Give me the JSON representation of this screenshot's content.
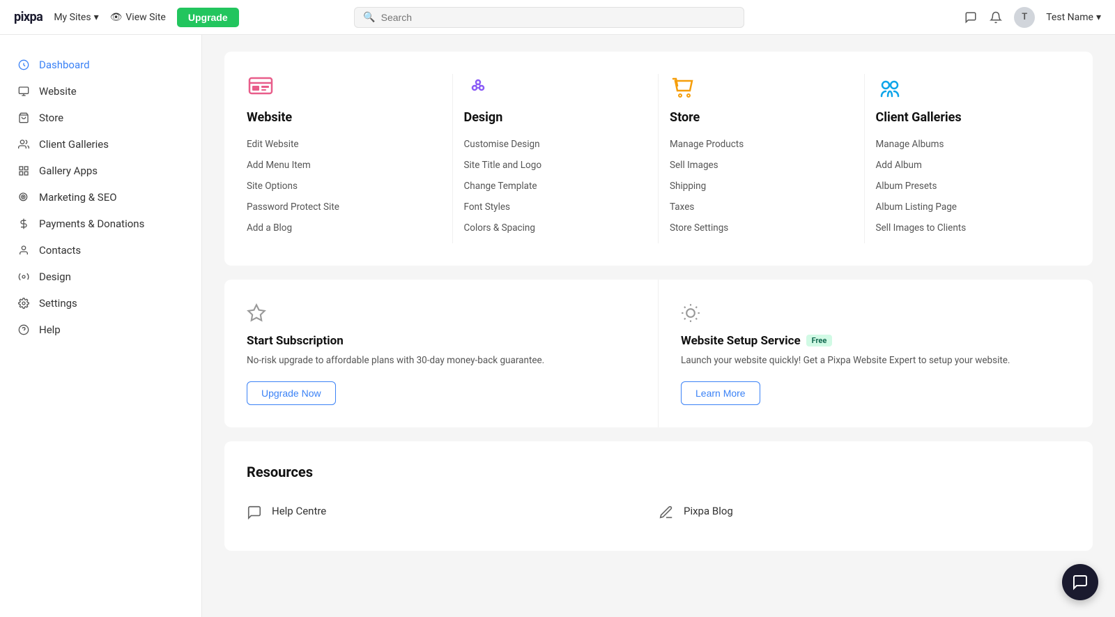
{
  "topnav": {
    "logo": "pixpa",
    "my_sites": "My Sites",
    "view_site": "View Site",
    "upgrade": "Upgrade",
    "search_placeholder": "Search",
    "username": "Test Name"
  },
  "sidebar": {
    "items": [
      {
        "id": "dashboard",
        "label": "Dashboard",
        "active": true
      },
      {
        "id": "website",
        "label": "Website",
        "active": false
      },
      {
        "id": "store",
        "label": "Store",
        "active": false
      },
      {
        "id": "client-galleries",
        "label": "Client Galleries",
        "active": false
      },
      {
        "id": "gallery-apps",
        "label": "Gallery Apps",
        "active": false
      },
      {
        "id": "marketing-seo",
        "label": "Marketing & SEO",
        "active": false
      },
      {
        "id": "payments-donations",
        "label": "Payments & Donations",
        "active": false
      },
      {
        "id": "contacts",
        "label": "Contacts",
        "active": false
      },
      {
        "id": "design",
        "label": "Design",
        "active": false
      },
      {
        "id": "settings",
        "label": "Settings",
        "active": false
      },
      {
        "id": "help",
        "label": "Help",
        "active": false
      }
    ]
  },
  "quick_access": {
    "columns": [
      {
        "id": "website",
        "title": "Website",
        "links": [
          "Edit Website",
          "Add Menu Item",
          "Site Options",
          "Password Protect Site",
          "Add a Blog"
        ]
      },
      {
        "id": "design",
        "title": "Design",
        "links": [
          "Customise Design",
          "Site Title and Logo",
          "Change Template",
          "Font Styles",
          "Colors & Spacing"
        ]
      },
      {
        "id": "store",
        "title": "Store",
        "links": [
          "Manage Products",
          "Sell Images",
          "Shipping",
          "Taxes",
          "Store Settings"
        ]
      },
      {
        "id": "client-galleries",
        "title": "Client Galleries",
        "links": [
          "Manage Albums",
          "Add Album",
          "Album Presets",
          "Album Listing Page",
          "Sell Images to Clients"
        ]
      }
    ]
  },
  "promo": {
    "cards": [
      {
        "id": "subscription",
        "title": "Start Subscription",
        "desc": "No-risk upgrade to affordable plans with 30-day money-back guarantee.",
        "btn_label": "Upgrade Now",
        "badge": null
      },
      {
        "id": "setup-service",
        "title": "Website Setup Service",
        "desc": "Launch your website quickly! Get a Pixpa Website Expert to setup your website.",
        "btn_label": "Learn More",
        "badge": "Free"
      }
    ]
  },
  "resources": {
    "title": "Resources",
    "items": [
      {
        "id": "help-centre",
        "label": "Help Centre"
      },
      {
        "id": "pixpa-blog",
        "label": "Pixpa Blog"
      }
    ]
  }
}
